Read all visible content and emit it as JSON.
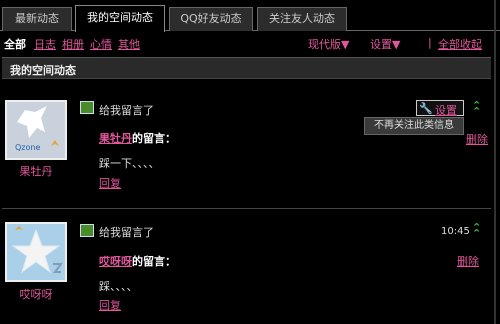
{
  "tabs": [
    {
      "label": "最新动态"
    },
    {
      "label": "我的空间动态"
    },
    {
      "label": "QQ好友动态"
    },
    {
      "label": "关注友人动态"
    }
  ],
  "filters": {
    "all": "全部",
    "links": [
      "日志",
      "相册",
      "心情",
      "其他"
    ],
    "view_mode": "现代版▼",
    "settings": "设置▼",
    "separator": "|",
    "collapse_all": "全部收起"
  },
  "section_title": "我的空间动态",
  "feed": [
    {
      "avatar_name": "果牡丹",
      "action": "给我留言了",
      "author": "果牡丹",
      "author_suffix": "的留言：",
      "message": "踩一下、、、、",
      "reply": "回复",
      "settings_label": "设置",
      "tooltip": "不再关注此类信息",
      "delete": "删除"
    },
    {
      "avatar_name": "哎呀呀",
      "action": "给我留言了",
      "author": "哎呀呀",
      "author_suffix": "的留言：",
      "message": "踩、、、、",
      "reply": "回复",
      "time": "10:45",
      "delete": "删除"
    }
  ],
  "colors": {
    "link": "#e0579b",
    "expand": "#3cc23c",
    "background": "#000000"
  }
}
